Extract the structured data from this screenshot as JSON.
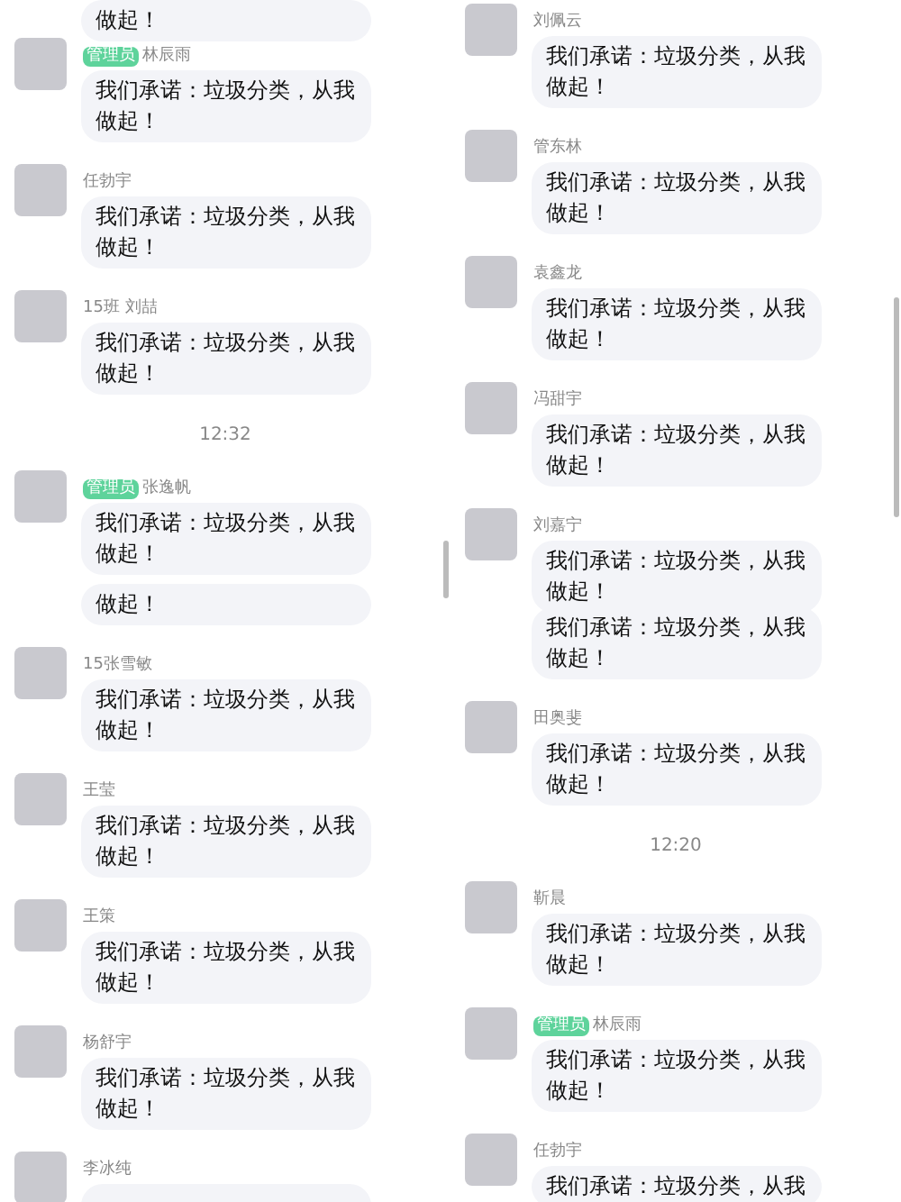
{
  "columns": [
    {
      "items": [
        {
          "kind": "fragment",
          "text": "做起！"
        },
        {
          "kind": "message",
          "badge": "管理员",
          "name": "林辰雨",
          "text": "我们承诺：垃圾分类，从我做起！"
        },
        {
          "kind": "message",
          "name": "任勃宇",
          "text": "我们承诺：垃圾分类，从我做起！"
        },
        {
          "kind": "message",
          "name": "15班 刘喆",
          "text": "我们承诺：垃圾分类，从我做起！"
        },
        {
          "kind": "time",
          "text": "12:32"
        },
        {
          "kind": "message",
          "badge": "管理员",
          "name": "张逸帆",
          "text": "我们承诺：垃圾分类，从我做起！"
        },
        {
          "kind": "fragment",
          "text": "做起！"
        },
        {
          "kind": "message",
          "name": "15张雪敏",
          "text": "我们承诺：垃圾分类，从我做起！"
        },
        {
          "kind": "message",
          "name": "王莹",
          "text": "我们承诺：垃圾分类，从我做起！"
        },
        {
          "kind": "message",
          "name": "王策",
          "text": "我们承诺：垃圾分类，从我做起！"
        },
        {
          "kind": "message",
          "name": "杨舒宇",
          "text": "我们承诺：垃圾分类，从我做起！"
        },
        {
          "kind": "message",
          "name": "李冰纯"
        }
      ]
    },
    {
      "items": [
        {
          "kind": "message",
          "name": "刘佩云",
          "text": "我们承诺：垃圾分类，从我做起！"
        },
        {
          "kind": "message",
          "name": "管东林",
          "text": "我们承诺：垃圾分类，从我做起！"
        },
        {
          "kind": "message",
          "name": "袁鑫龙",
          "text": "我们承诺：垃圾分类，从我做起！"
        },
        {
          "kind": "message",
          "name": "冯甜宇",
          "text": "我们承诺：垃圾分类，从我做起！"
        },
        {
          "kind": "message",
          "name": "刘嘉宁",
          "text": "我们承诺：垃圾分类，从我做起！"
        },
        {
          "kind": "fragment",
          "text": "我们承诺：垃圾分类，从我做起！"
        },
        {
          "kind": "message",
          "name": "田奥斐",
          "text": "我们承诺：垃圾分类，从我做起！"
        },
        {
          "kind": "time",
          "text": "12:20"
        },
        {
          "kind": "message",
          "name": "靳晨",
          "text": "我们承诺：垃圾分类，从我做起！"
        },
        {
          "kind": "message",
          "badge": "管理员",
          "name": "林辰雨",
          "text": "我们承诺：垃圾分类，从我做起！"
        },
        {
          "kind": "message",
          "name": "任勃宇",
          "text": "我们承诺：垃圾分类，从我"
        }
      ]
    }
  ]
}
